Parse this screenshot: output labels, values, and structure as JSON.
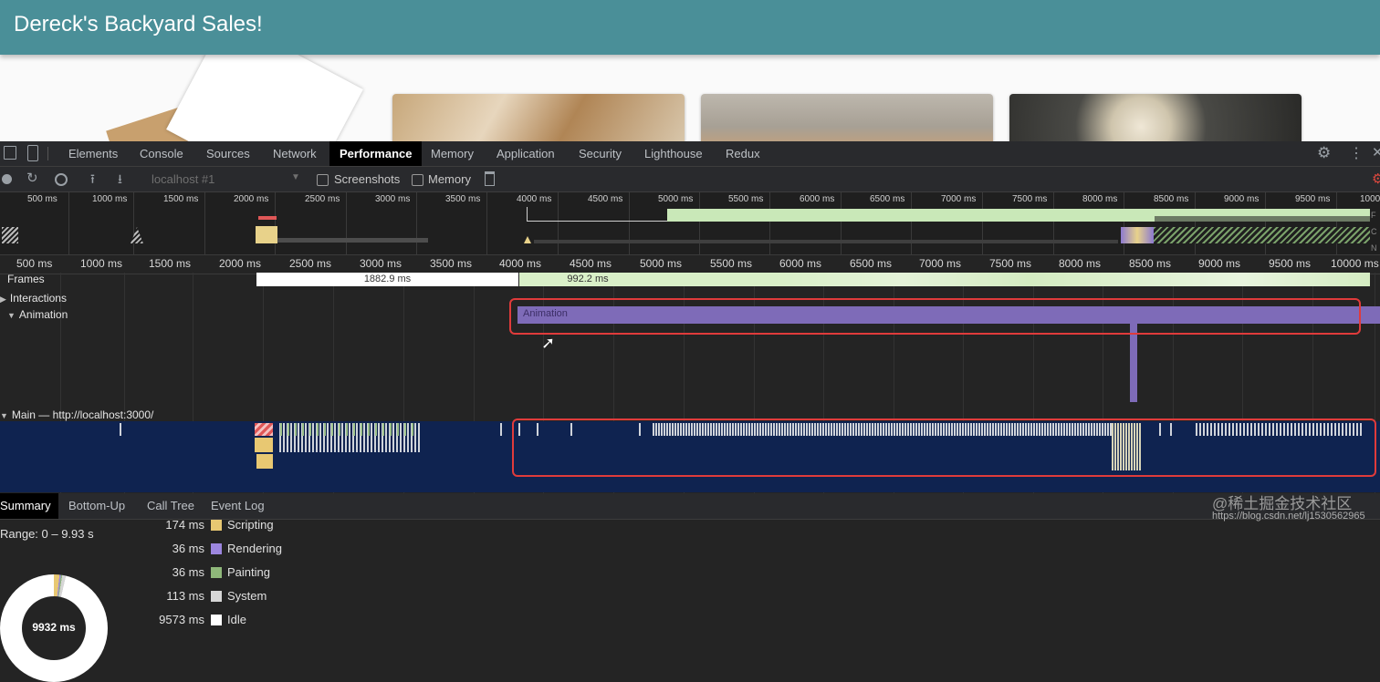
{
  "site": {
    "title": "Dereck's Backyard Sales!"
  },
  "devtools": {
    "tabs": [
      "Elements",
      "Console",
      "Sources",
      "Network",
      "Performance",
      "Memory",
      "Application",
      "Security",
      "Lighthouse",
      "Redux"
    ],
    "active_tab": "Performance",
    "toolbar": {
      "target": "localhost #1",
      "screenshots_label": "Screenshots",
      "memory_label": "Memory",
      "screenshots_checked": false,
      "memory_checked": false
    },
    "overview_ticks": [
      "500 ms",
      "1000 ms",
      "1500 ms",
      "2000 ms",
      "2500 ms",
      "3000 ms",
      "3500 ms",
      "4000 ms",
      "4500 ms",
      "5000 ms",
      "5500 ms",
      "6000 ms",
      "6500 ms",
      "7000 ms",
      "7500 ms",
      "8000 ms",
      "8500 ms",
      "9000 ms",
      "9500 ms",
      "1000"
    ],
    "ruler_ticks": [
      "500 ms",
      "1000 ms",
      "1500 ms",
      "2000 ms",
      "2500 ms",
      "3000 ms",
      "3500 ms",
      "4000 ms",
      "4500 ms",
      "5000 ms",
      "5500 ms",
      "6000 ms",
      "6500 ms",
      "7000 ms",
      "7500 ms",
      "8000 ms",
      "8500 ms",
      "9000 ms",
      "9500 ms",
      "10000 ms"
    ],
    "tracks": {
      "frames": "Frames",
      "frame_1": "1882.9 ms",
      "frame_2": "992.2 ms",
      "interactions": "Interactions",
      "animation": "Animation",
      "animation_bar": "Animation",
      "main": "Main — http://localhost:3000/"
    },
    "bottom_tabs": [
      "Summary",
      "Bottom-Up",
      "Call Tree",
      "Event Log"
    ],
    "active_bottom_tab": "Summary",
    "summary": {
      "range": "Range: 0 – 9.93 s",
      "total": "9932 ms",
      "rows": [
        {
          "value": "174 ms",
          "name": "Scripting",
          "color": "#e8c872"
        },
        {
          "value": "36 ms",
          "name": "Rendering",
          "color": "#9c86de"
        },
        {
          "value": "36 ms",
          "name": "Painting",
          "color": "#8fb87a"
        },
        {
          "value": "113 ms",
          "name": "System",
          "color": "#d6d6d6"
        },
        {
          "value": "9573 ms",
          "name": "Idle",
          "color": "#ffffff"
        }
      ]
    }
  },
  "watermark": {
    "text": "@稀土掘金技术社区",
    "url": "https://blog.csdn.net/lj1530562965"
  },
  "colors": {
    "header": "#4a8f98",
    "highlight": "#e03b3b",
    "animation": "#7e6bb8",
    "main_band": "#0f2350"
  }
}
